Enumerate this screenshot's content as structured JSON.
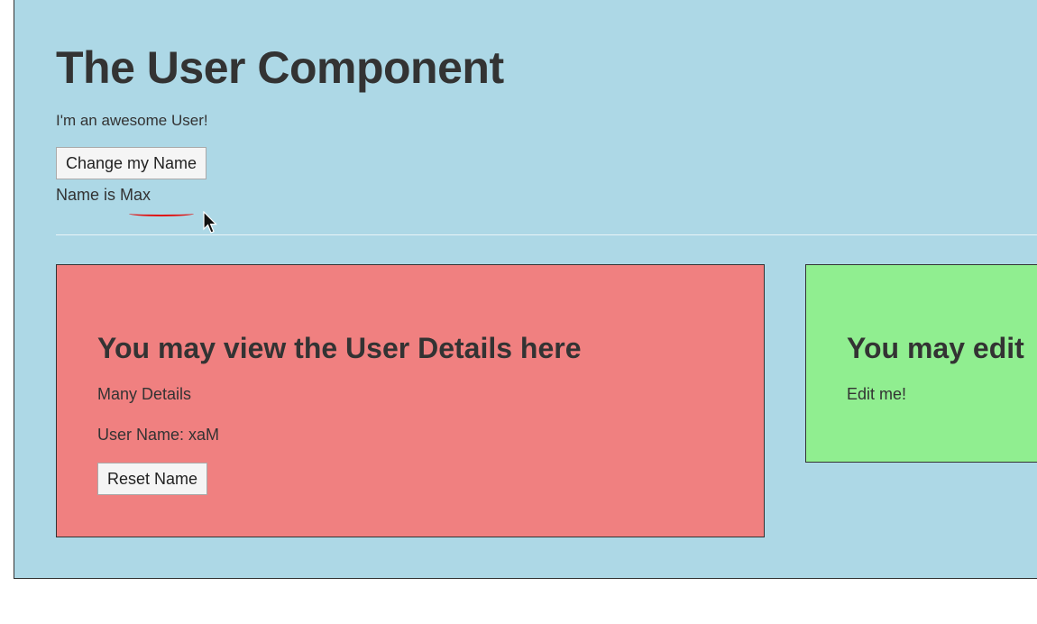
{
  "user_component": {
    "title": "The User Component",
    "subtitle": "I'm an awesome User!",
    "change_name_button": "Change my Name",
    "name_line": "Name is Max"
  },
  "detail_panel": {
    "heading": "You may view the User Details here",
    "details_text": "Many Details",
    "user_name_line": "User Name: xaM",
    "reset_button": "Reset Name",
    "background": "#f08080"
  },
  "edit_panel": {
    "heading": "You may edit",
    "text": "Edit me!",
    "background": "#90ee90"
  },
  "colors": {
    "page_background": "#add8e6",
    "annotation_underline": "#e01010"
  },
  "icons": {
    "cursor": "mouse-pointer-icon"
  }
}
